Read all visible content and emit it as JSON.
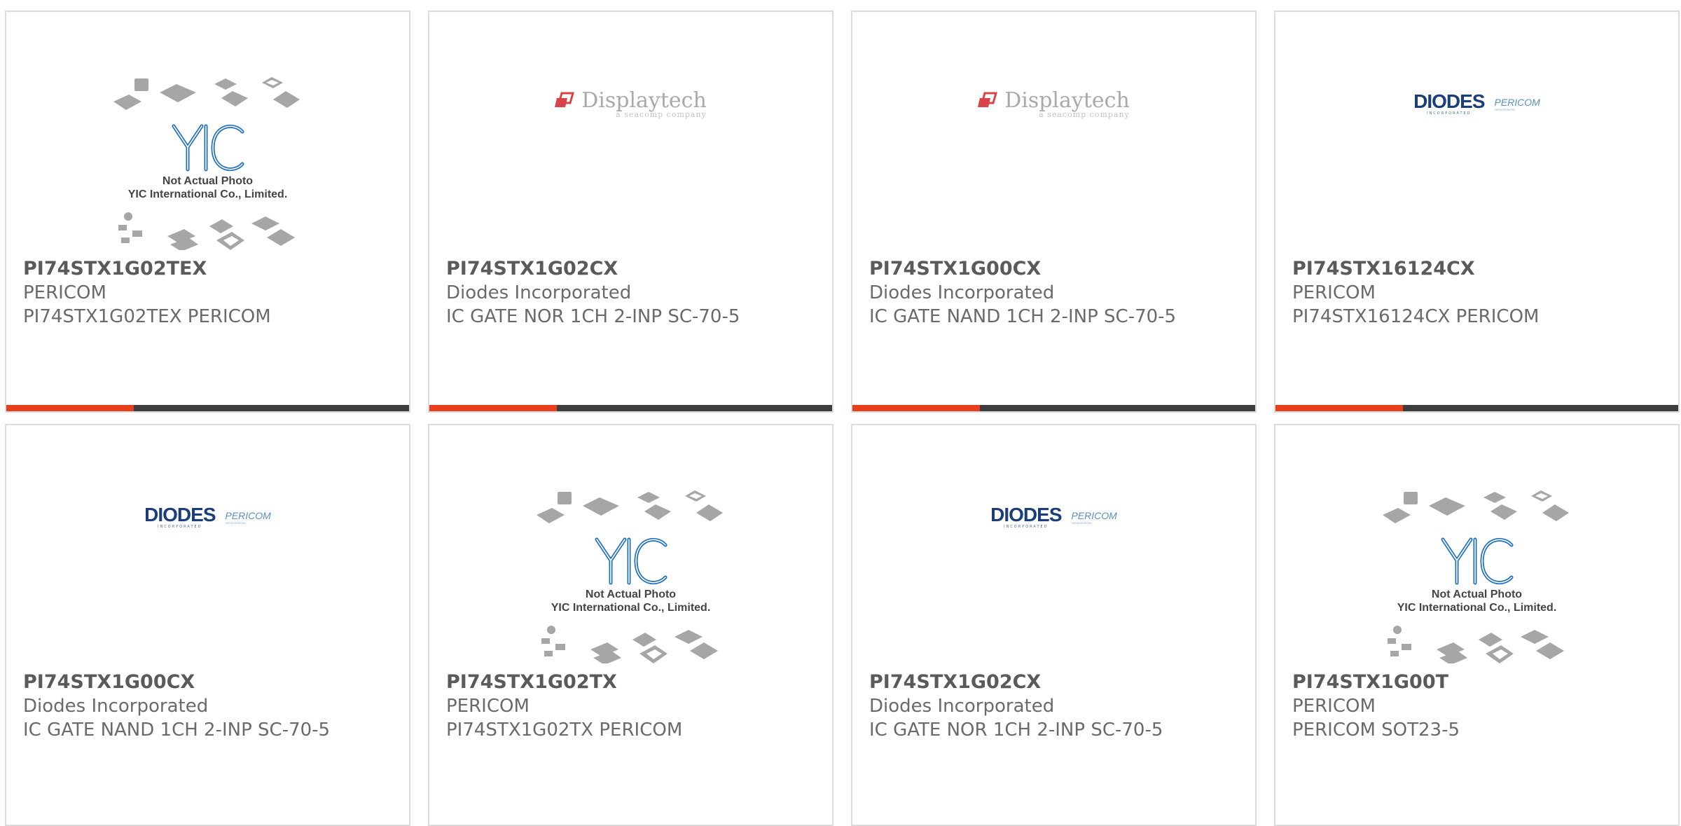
{
  "colors": {
    "accent": "#e8401c",
    "bar": "#3d3d3d",
    "border": "#dcdcdc",
    "text": "#6a6a6a",
    "yic_blue": "#1e6fc0",
    "displaytech_red": "#d9434a",
    "diodes_blue": "#1b3e78"
  },
  "placeholders": {
    "yic_logo_text": "YIC",
    "yic_line1": "Not Actual Photo",
    "yic_line2": "YIC International Co., Limited.",
    "displaytech_word": "Displaytech",
    "displaytech_sub": "a seacomp company",
    "diodes_word": "DIODES",
    "diodes_sub": "INCORPORATED",
    "pericom_word": "PERICOM",
    "pericom_sub": "semiconductor"
  },
  "products": [
    {
      "part_number": "PI74STX1G02TEX",
      "manufacturer": "PERICOM",
      "description": "PI74STX1G02TEX PERICOM",
      "image": "yic-placeholder"
    },
    {
      "part_number": "PI74STX1G02CX",
      "manufacturer": "Diodes Incorporated",
      "description": "IC GATE NOR 1CH 2-INP SC-70-5",
      "image": "displaytech-logo"
    },
    {
      "part_number": "PI74STX1G00CX",
      "manufacturer": "Diodes Incorporated",
      "description": "IC GATE NAND 1CH 2-INP SC-70-5",
      "image": "displaytech-logo"
    },
    {
      "part_number": "PI74STX16124CX",
      "manufacturer": "PERICOM",
      "description": "PI74STX16124CX PERICOM",
      "image": "diodes-pericom-logo"
    },
    {
      "part_number": "PI74STX1G00CX",
      "manufacturer": "Diodes Incorporated",
      "description": "IC GATE NAND 1CH 2-INP SC-70-5",
      "image": "diodes-pericom-logo"
    },
    {
      "part_number": "PI74STX1G02TX",
      "manufacturer": "PERICOM",
      "description": "PI74STX1G02TX PERICOM",
      "image": "yic-placeholder"
    },
    {
      "part_number": "PI74STX1G02CX",
      "manufacturer": "Diodes Incorporated",
      "description": "IC GATE NOR 1CH 2-INP SC-70-5",
      "image": "diodes-pericom-logo"
    },
    {
      "part_number": "PI74STX1G00T",
      "manufacturer": "PERICOM",
      "description": "PERICOM SOT23-5",
      "image": "yic-placeholder"
    }
  ]
}
